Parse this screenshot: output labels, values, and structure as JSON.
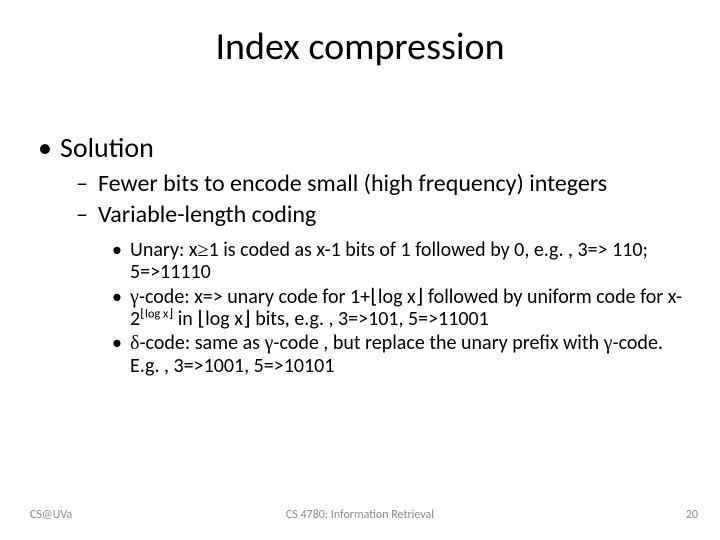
{
  "title": "Index compression",
  "bullets": {
    "l1": "Solution",
    "l2a": "Fewer bits to encode small (high frequency) integers",
    "l2b": "Variable-length coding",
    "l3a_pre": "Unary: x",
    "l3a_post": "1 is coded as x-1 bits of 1 followed by 0, e.g. , 3=> 110; 5=>11110",
    "l3b": "-code: x=> unary code for 1+⌊log x⌋ followed by uniform code for x-2",
    "l3b_sup": "⌊log x⌋",
    "l3b_tail": " in ⌊log x⌋  bits, e.g. , 3=>101, 5=>11001",
    "l3c_pre": "-code: same as ",
    "l3c_post": "-code , but replace the unary prefix with ",
    "l3c_tail": "-code. E.g. , 3=>1001, 5=>10101"
  },
  "sym": {
    "ge": "≥",
    "gamma": "γ",
    "delta": "δ"
  },
  "footer": {
    "left": "CS@UVa",
    "center": "CS 4780: Information Retrieval",
    "right": "20"
  }
}
